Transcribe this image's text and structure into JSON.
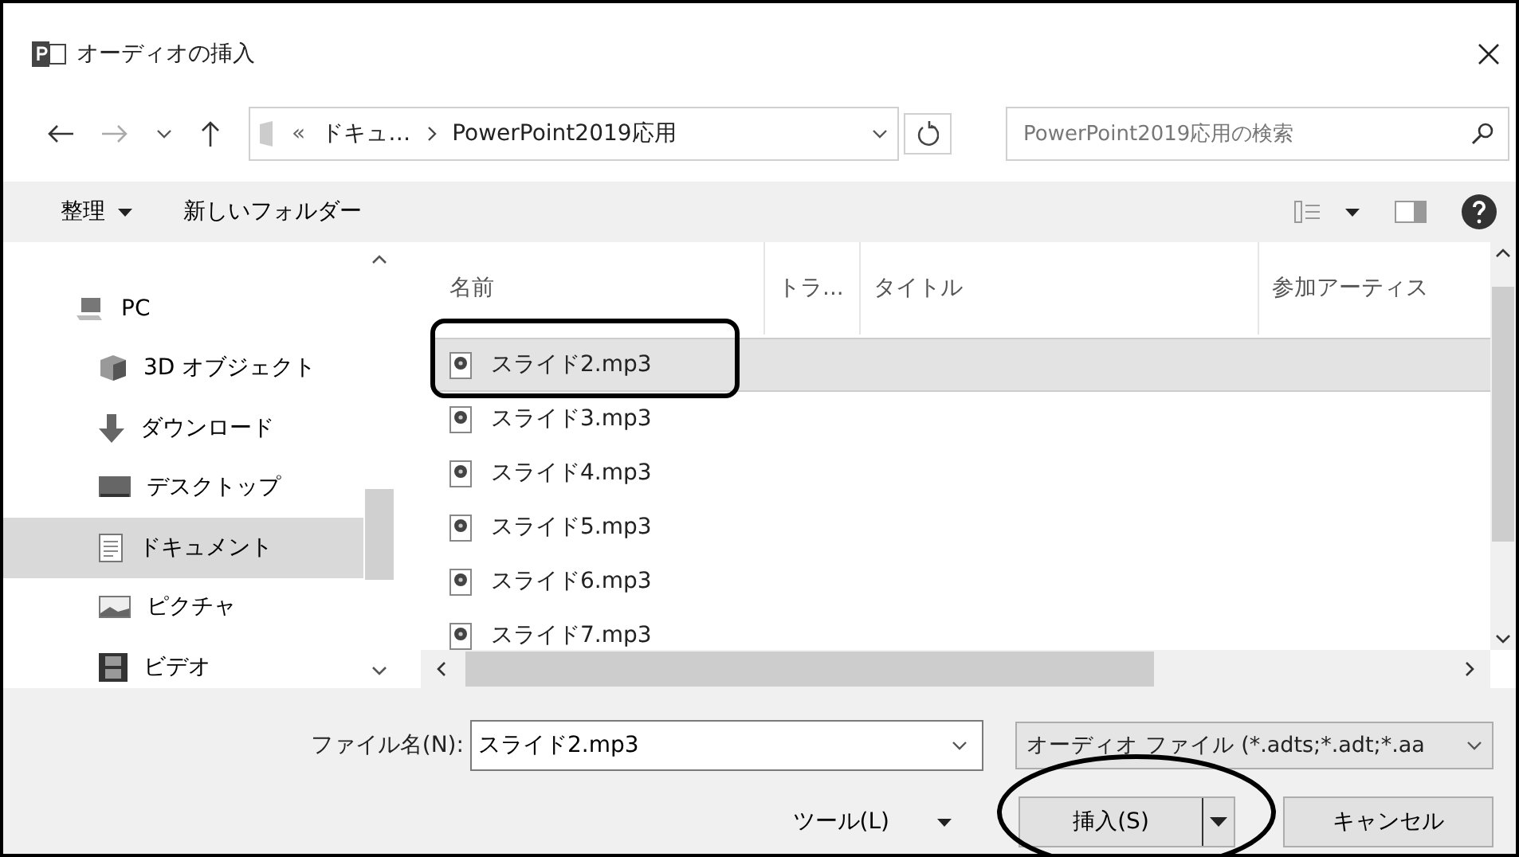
{
  "window": {
    "title": "オーディオの挿入"
  },
  "address": {
    "overflow": "«",
    "crumbs": [
      "ドキュ…",
      "PowerPoint2019応用"
    ]
  },
  "search": {
    "placeholder": "PowerPoint2019応用の検索"
  },
  "toolbar": {
    "organize": "整理",
    "new_folder": "新しいフォルダー"
  },
  "sidebar": {
    "items": [
      {
        "label": "PC",
        "kind": "pc",
        "selected": false
      },
      {
        "label": "3D オブジェクト",
        "kind": "cube",
        "selected": false
      },
      {
        "label": "ダウンロード",
        "kind": "download",
        "selected": false
      },
      {
        "label": "デスクトップ",
        "kind": "desktop",
        "selected": false
      },
      {
        "label": "ドキュメント",
        "kind": "document",
        "selected": true
      },
      {
        "label": "ピクチャ",
        "kind": "picture",
        "selected": false
      },
      {
        "label": "ビデオ",
        "kind": "video",
        "selected": false
      }
    ]
  },
  "table": {
    "columns": [
      "名前",
      "トラ...",
      "タイトル",
      "参加アーティス"
    ],
    "rows": [
      {
        "name": "スライド2.mp3",
        "selected": true
      },
      {
        "name": "スライド3.mp3",
        "selected": false
      },
      {
        "name": "スライド4.mp3",
        "selected": false
      },
      {
        "name": "スライド5.mp3",
        "selected": false
      },
      {
        "name": "スライド6.mp3",
        "selected": false
      },
      {
        "name": "スライド7.mp3",
        "selected": false
      }
    ]
  },
  "footer": {
    "filename_label": "ファイル名(N):",
    "filename": "スライド2.mp3",
    "filetype": "オーディオ ファイル (*.adts;*.adt;*.aa",
    "tools": "ツール(L)",
    "insert": "挿入(S)",
    "cancel": "キャンセル"
  }
}
